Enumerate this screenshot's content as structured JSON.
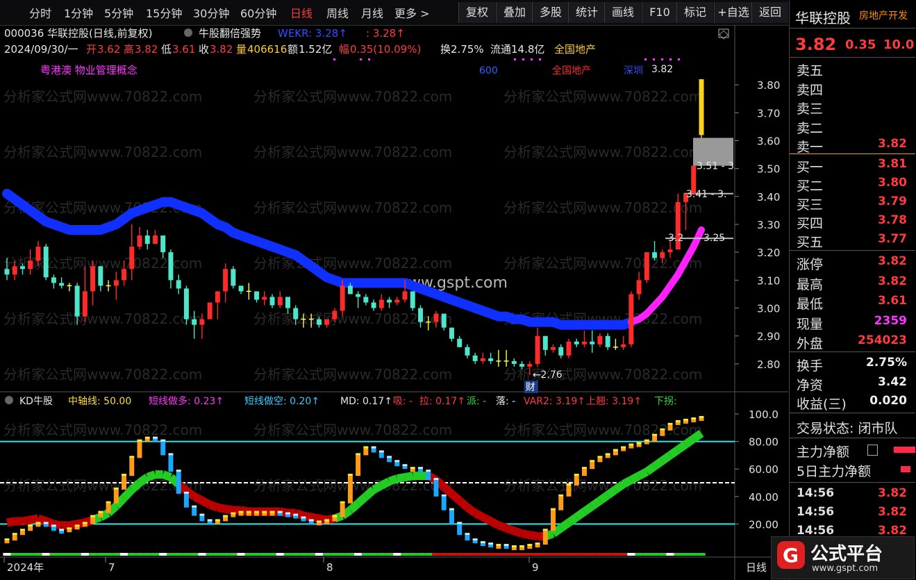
{
  "topbar": {
    "tabs": [
      "分时",
      "1分钟",
      "5分钟",
      "15分钟",
      "30分钟",
      "60分钟",
      "日线",
      "周线",
      "月线",
      "更多 >"
    ],
    "active_tab": "日线",
    "buttons": [
      "复权",
      "叠加",
      "多股",
      "统计",
      "画线",
      "F10",
      "标记",
      "+自选",
      "返回"
    ]
  },
  "header": {
    "code_name": "000036 华联控股(日线,前复权)",
    "indicator_name": "牛股翻倍强势",
    "wekr_label": "WEKR: 3.28↑",
    "wekr_val2": ": 3.28↑",
    "date": "2024/09/30/一",
    "open_label": "开",
    "open": "3.62",
    "high_label": "高",
    "high": "3.82",
    "low_label": "低",
    "low": "3.61",
    "close_label": "收",
    "close": "3.82",
    "vol_label": "量",
    "vol": "406616",
    "amt_label": "额",
    "amt": "1.52亿",
    "chg_label": "幅",
    "chg": "0.35(10.09%)",
    "turn": "换2.75%",
    "float": "流通14.8亿",
    "sector": "全国地产",
    "concepts": "粤港澳 物业管理概念",
    "mark_600": "600",
    "mark_sector": "全国地产",
    "mark_deep": "深圳",
    "price_tag": "3.82"
  },
  "price_axis": [
    "3.80",
    "3.70",
    "3.60",
    "3.50",
    "3.40",
    "3.30",
    "3.20",
    "3.10",
    "3.00",
    "2.90",
    "2.80"
  ],
  "price_annotations": {
    "low": "2.76",
    "a": "3.51 - 3",
    "b": "3.41 - 3.",
    "c": "3.2",
    "d": "3.25",
    "cai": "财"
  },
  "watermarks": {
    "site": "分析家公式网www.70822.com",
    "center": "www.gspt.com"
  },
  "indicator_header": {
    "name": "KD牛股",
    "zz": "中轴线: 50.00",
    "dx_dd": "短线做多: 0.23↑",
    "dx_dk": "短线做空: 0.20↑",
    "md": "MD: 0.17↑",
    "xi": "吸: -",
    "la": "拉: 0.17↑",
    "pai": "派: -",
    "luo": "落: -",
    "var2": "VAR2: 3.19↑",
    "sq": "上翘: 3.19↑",
    "xg": "下拐:"
  },
  "indicator_axis": [
    "100.0",
    "80.00",
    "60.00",
    "40.00",
    "20.00"
  ],
  "xaxis": {
    "labels": [
      "2024年",
      "7",
      "8",
      "9"
    ],
    "period": "日线"
  },
  "sidebar": {
    "name": "华联控股",
    "sector_tag": "房地产开发",
    "price": "3.82",
    "change": "0.35",
    "pct": "10.0",
    "asks": [
      {
        "l": "卖五",
        "v": ""
      },
      {
        "l": "卖四",
        "v": ""
      },
      {
        "l": "卖三",
        "v": ""
      },
      {
        "l": "卖二",
        "v": ""
      },
      {
        "l": "卖一",
        "v": "3.82"
      }
    ],
    "bids": [
      {
        "l": "买一",
        "v": "3.81"
      },
      {
        "l": "买二",
        "v": "3.80"
      },
      {
        "l": "买三",
        "v": "3.79"
      },
      {
        "l": "买四",
        "v": "3.78"
      },
      {
        "l": "买五",
        "v": "3.77"
      }
    ],
    "stats": [
      {
        "l": "涨停",
        "v": "3.82"
      },
      {
        "l": "最高",
        "v": "3.82"
      },
      {
        "l": "最低",
        "v": "3.61"
      },
      {
        "l": "现量",
        "v": "2359"
      },
      {
        "l": "外盘",
        "v": "254023"
      }
    ],
    "fin": [
      {
        "l": "换手",
        "v": "2.75%"
      },
      {
        "l": "净资",
        "v": "3.42"
      },
      {
        "l": "收益(三)",
        "v": "0.020"
      }
    ],
    "trade_state": "交易状态: 闭市队",
    "flow1": "主力净额",
    "flow2": "5日主力净额",
    "ticks": [
      {
        "t": "14:56",
        "p": "3.82"
      },
      {
        "t": "14:56",
        "p": "3.82"
      },
      {
        "t": "14:56",
        "p": "3.82"
      }
    ]
  },
  "brand": {
    "name": "公式平台",
    "url": "www.gspt.com"
  },
  "colors": {
    "up": "#ff2a2a",
    "down": "#4ee6c8",
    "ma": "#1030ff",
    "ma_hot": "#ff20ff",
    "cross": "#ffff40"
  },
  "chart_data": {
    "type": "candlestick",
    "ylim": [
      2.72,
      3.86
    ],
    "candles": [
      [
        3.14,
        3.12,
        3.18,
        3.1
      ],
      [
        3.12,
        3.15,
        3.17,
        3.1
      ],
      [
        3.15,
        3.14,
        3.16,
        3.12
      ],
      [
        3.14,
        3.17,
        3.21,
        3.12
      ],
      [
        3.17,
        3.22,
        3.24,
        3.15
      ],
      [
        3.22,
        3.11,
        3.23,
        3.1
      ],
      [
        3.11,
        3.09,
        3.12,
        3.07
      ],
      [
        3.09,
        3.08,
        3.11,
        3.07
      ],
      [
        3.08,
        3.08,
        3.09,
        3.06
      ],
      [
        3.08,
        2.97,
        3.09,
        2.94
      ],
      [
        2.97,
        3.06,
        3.15,
        2.95
      ],
      [
        3.06,
        3.15,
        3.17,
        3.01
      ],
      [
        3.15,
        3.08,
        3.15,
        3.06
      ],
      [
        3.08,
        3.08,
        3.1,
        3.06
      ],
      [
        3.08,
        3.1,
        3.13,
        3.03
      ],
      [
        3.1,
        3.14,
        3.17,
        3.08
      ],
      [
        3.14,
        3.22,
        3.3,
        3.1
      ],
      [
        3.22,
        3.26,
        3.29,
        3.21
      ],
      [
        3.26,
        3.23,
        3.28,
        3.21
      ],
      [
        3.23,
        3.26,
        3.28,
        3.23
      ],
      [
        3.26,
        3.2,
        3.26,
        3.18
      ],
      [
        3.2,
        3.1,
        3.21,
        3.07
      ],
      [
        3.1,
        3.07,
        3.12,
        3.05
      ],
      [
        3.07,
        2.96,
        3.08,
        2.94
      ],
      [
        2.96,
        2.94,
        2.99,
        2.89
      ],
      [
        2.94,
        2.96,
        2.98,
        2.89
      ],
      [
        2.96,
        3.02,
        3.02,
        2.96
      ],
      [
        3.02,
        3.06,
        3.06,
        2.96
      ],
      [
        3.06,
        3.14,
        3.16,
        3.02
      ],
      [
        3.14,
        3.08,
        3.15,
        3.07
      ],
      [
        3.08,
        3.06,
        3.08,
        3.05
      ],
      [
        3.06,
        3.06,
        3.09,
        3.03
      ],
      [
        3.06,
        3.03,
        3.06,
        3.02
      ],
      [
        3.03,
        3.04,
        3.06,
        3.01
      ],
      [
        3.04,
        3.01,
        3.05,
        3.0
      ],
      [
        3.01,
        3.04,
        3.06,
        3.0
      ],
      [
        3.04,
        3.0,
        3.04,
        2.98
      ],
      [
        3.0,
        2.96,
        3.01,
        2.94
      ],
      [
        2.96,
        2.96,
        2.98,
        2.93
      ],
      [
        2.96,
        2.96,
        2.98,
        2.93
      ],
      [
        2.96,
        2.94,
        2.97,
        2.93
      ],
      [
        2.94,
        2.96,
        2.96,
        2.93
      ],
      [
        2.96,
        2.99,
        3.0,
        2.95
      ],
      [
        2.99,
        3.08,
        3.1,
        2.97
      ],
      [
        3.08,
        3.05,
        3.09,
        3.05
      ],
      [
        3.05,
        3.04,
        3.06,
        3.0
      ],
      [
        3.04,
        3.02,
        3.05,
        3.01
      ],
      [
        3.02,
        3.0,
        3.03,
        2.99
      ],
      [
        3.0,
        3.03,
        3.05,
        2.99
      ],
      [
        3.03,
        3.02,
        3.04,
        3.0
      ],
      [
        3.02,
        3.03,
        3.04,
        3.01
      ],
      [
        3.03,
        3.06,
        3.1,
        3.02
      ],
      [
        3.06,
        3.0,
        3.06,
        2.99
      ],
      [
        3.0,
        2.95,
        3.01,
        2.93
      ],
      [
        2.95,
        2.95,
        2.97,
        2.92
      ],
      [
        2.95,
        2.98,
        2.99,
        2.93
      ],
      [
        2.98,
        2.93,
        2.98,
        2.92
      ],
      [
        2.93,
        2.89,
        2.93,
        2.88
      ],
      [
        2.89,
        2.86,
        2.9,
        2.86
      ],
      [
        2.86,
        2.83,
        2.87,
        2.82
      ],
      [
        2.83,
        2.81,
        2.84,
        2.8
      ],
      [
        2.81,
        2.82,
        2.84,
        2.8
      ],
      [
        2.82,
        2.81,
        2.84,
        2.8
      ],
      [
        2.81,
        2.81,
        2.85,
        2.79
      ],
      [
        2.81,
        2.81,
        2.85,
        2.79
      ],
      [
        2.81,
        2.8,
        2.82,
        2.79
      ],
      [
        2.8,
        2.79,
        2.81,
        2.78
      ],
      [
        2.79,
        2.8,
        2.81,
        2.76
      ],
      [
        2.8,
        2.9,
        2.93,
        2.79
      ],
      [
        2.9,
        2.85,
        2.9,
        2.83
      ],
      [
        2.85,
        2.86,
        2.87,
        2.84
      ],
      [
        2.86,
        2.83,
        2.87,
        2.82
      ],
      [
        2.83,
        2.88,
        2.89,
        2.82
      ],
      [
        2.88,
        2.87,
        2.89,
        2.86
      ],
      [
        2.87,
        2.88,
        2.92,
        2.86
      ],
      [
        2.88,
        2.87,
        2.92,
        2.84
      ],
      [
        2.87,
        2.9,
        2.91,
        2.86
      ],
      [
        2.9,
        2.86,
        2.91,
        2.85
      ],
      [
        2.86,
        2.86,
        2.89,
        2.85
      ],
      [
        2.86,
        2.87,
        2.9,
        2.85
      ],
      [
        2.87,
        3.05,
        3.06,
        2.86
      ],
      [
        3.05,
        3.1,
        3.13,
        3.03
      ],
      [
        3.1,
        3.2,
        3.2,
        3.09
      ],
      [
        3.2,
        3.18,
        3.24,
        3.17
      ],
      [
        3.18,
        3.2,
        3.21,
        3.16
      ],
      [
        3.2,
        3.21,
        3.24,
        3.18
      ],
      [
        3.21,
        3.38,
        3.41,
        3.24
      ],
      [
        3.38,
        3.41,
        3.41,
        3.28
      ],
      [
        3.41,
        3.51,
        3.51,
        3.45
      ],
      [
        3.62,
        3.82,
        3.82,
        3.61
      ]
    ],
    "ma_line": [
      3.41,
      3.39,
      3.37,
      3.35,
      3.33,
      3.31,
      3.3,
      3.29,
      3.28,
      3.28,
      3.28,
      3.28,
      3.28,
      3.29,
      3.3,
      3.32,
      3.34,
      3.35,
      3.36,
      3.37,
      3.38,
      3.38,
      3.37,
      3.36,
      3.35,
      3.34,
      3.32,
      3.3,
      3.29,
      3.27,
      3.26,
      3.25,
      3.24,
      3.23,
      3.22,
      3.21,
      3.2,
      3.19,
      3.17,
      3.15,
      3.13,
      3.11,
      3.1,
      3.09,
      3.09,
      3.09,
      3.09,
      3.09,
      3.09,
      3.09,
      3.09,
      3.09,
      3.08,
      3.07,
      3.06,
      3.05,
      3.04,
      3.03,
      3.02,
      3.01,
      3.0,
      2.99,
      2.98,
      2.97,
      2.97,
      2.96,
      2.96,
      2.95,
      2.95,
      2.95,
      2.95,
      2.94,
      2.94,
      2.94,
      2.94,
      2.94,
      2.94,
      2.94,
      2.94,
      2.94,
      2.95,
      2.96,
      2.98,
      3.01,
      3.04,
      3.08,
      3.12,
      3.17,
      3.22,
      3.28
    ],
    "kd_line": [
      8,
      12,
      15,
      18,
      20,
      18,
      15,
      14,
      16,
      18,
      20,
      25,
      28,
      35,
      45,
      55,
      68,
      80,
      82,
      80,
      70,
      58,
      42,
      32,
      26,
      22,
      20,
      22,
      25,
      27,
      28,
      28,
      28,
      28,
      28,
      27,
      26,
      24,
      22,
      20,
      21,
      22,
      25,
      35,
      55,
      70,
      75,
      72,
      68,
      65,
      62,
      60,
      60,
      58,
      52,
      40,
      30,
      20,
      12,
      8,
      6,
      5,
      4,
      4,
      3,
      3,
      3,
      4,
      5,
      15,
      30,
      40,
      48,
      55,
      60,
      65,
      68,
      70,
      73,
      75,
      77,
      78,
      80,
      84,
      88,
      92,
      94,
      95,
      96,
      97
    ],
    "kd_ribbon": [
      21,
      22,
      22,
      23,
      24,
      22,
      20,
      19,
      19,
      20,
      21,
      23,
      25,
      28,
      33,
      39,
      45,
      50,
      54,
      56,
      56,
      54,
      49,
      44,
      40,
      37,
      34,
      32,
      31,
      30,
      30,
      29,
      29,
      29,
      29,
      29,
      28,
      28,
      26,
      25,
      24,
      23,
      24,
      26,
      30,
      35,
      40,
      45,
      48,
      51,
      53,
      54,
      55,
      55,
      55,
      52,
      47,
      42,
      37,
      32,
      28,
      25,
      22,
      19,
      17,
      15,
      13,
      12,
      11,
      11,
      13,
      17,
      21,
      25,
      29,
      33,
      37,
      41,
      45,
      49,
      52,
      55,
      58,
      62,
      66,
      70,
      74,
      78,
      82,
      86
    ]
  }
}
